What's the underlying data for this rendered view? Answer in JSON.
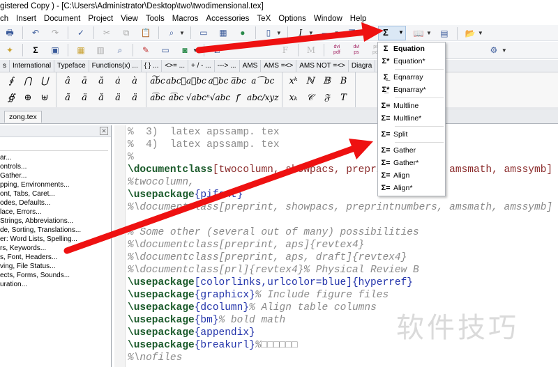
{
  "title": "gistered  Copy ) - [C:\\Users\\Administrator\\Desktop\\two\\twodimensional.tex]",
  "menu": [
    "ch",
    "Insert",
    "Document",
    "Project",
    "View",
    "Tools",
    "Macros",
    "Accessories",
    "TeX",
    "Options",
    "Window",
    "Help"
  ],
  "toolbar2_text": {
    "L": "L",
    "F": "F",
    "M": "M",
    "dvipdf": "dvi pdf",
    "dvips": "dvi ps",
    "pspdf": "ps pdf"
  },
  "symbol_tabs": [
    "s",
    "International",
    "Typeface",
    "Functions(x) ...",
    "{ } ...",
    "<>= ...",
    "+ / - ...",
    "---> ...",
    "AMS",
    "AMS =<>",
    "AMS NOT =<>",
    "Diagra"
  ],
  "symbols": {
    "g1": [
      "∮",
      "∯",
      "⋂",
      "⊕",
      "⋃",
      "⊎"
    ],
    "g2": [
      "â",
      "ã",
      "ā",
      "ä",
      "ă",
      "ă",
      "ȧ",
      "ä",
      "à",
      "ä"
    ],
    "g3": [
      "a͠bc",
      "a͡bc",
      "abc⃖",
      "a͡bc",
      "a⃖bc",
      "√abc",
      "a⃗bc",
      "ⁿ√abc",
      "a̅bc",
      "f′",
      "a⏜bc",
      "abc/xyz"
    ],
    "g4": [
      "xᵏ",
      "xₖ",
      "ℕ",
      "𝒞",
      "𝔹",
      "𝔉",
      "B",
      "T"
    ]
  },
  "file_tab": "zong.tex",
  "left_panel": {
    "items": [
      "ar...",
      "ontrols...",
      "Gather...",
      "pping, Environments...",
      "ont, Tabs, Caret...",
      "odes, Defaults...",
      "lace, Errors...",
      "Strings, Abbreviations...",
      "de, Sorting, Translations...",
      "er: Word Lists, Spelling...",
      "rs, Keywords...",
      "s, Font, Headers...",
      "ving, File Status...",
      "ects, Forms, Sounds...",
      "uration..."
    ]
  },
  "editor": {
    "lines": [
      {
        "t": "cm",
        "s": "%  3)  latex apssamp. tex"
      },
      {
        "t": "cm",
        "s": "%  4)  latex apssamp. tex"
      },
      {
        "t": "cm",
        "s": "%"
      },
      {
        "t": "code",
        "k": "\\documentclass",
        "a": "[twocolumn, showpacs, preprintnumbers, amsmath, amssymb]"
      },
      {
        "t": "cm",
        "s": "%twocolumn,"
      },
      {
        "t": "code",
        "k": "\\usepackage",
        "a": "{pifont}"
      },
      {
        "t": "cm",
        "s": "%\\documentclass[preprint, showpacs, preprintnumbers, amsmath, amssymb]"
      },
      {
        "t": "cm",
        "s": ""
      },
      {
        "t": "cm",
        "s": "% Some other (several out of many) possibilities"
      },
      {
        "t": "cm",
        "s": "%\\documentclass[preprint, aps]{revtex4}"
      },
      {
        "t": "cm",
        "s": "%\\documentclass[preprint, aps, draft]{revtex4}"
      },
      {
        "t": "cm",
        "s": "%\\documentclass[prl]{revtex4}% Physical Review B"
      },
      {
        "t": "code",
        "k": "\\usepackage",
        "a": "[colorlinks,urlcolor=blue]{hyperref}"
      },
      {
        "t": "code",
        "k": "\\usepackage",
        "a": "{graphicx}",
        "c": "% Include figure files"
      },
      {
        "t": "code",
        "k": "\\usepackage",
        "a": "{dcolumn}",
        "c": "% Align table columns"
      },
      {
        "t": "code",
        "k": "\\usepackage",
        "a": "{bm}",
        "c": "% bold math"
      },
      {
        "t": "code",
        "k": "\\usepackage",
        "a": "{appendix}"
      },
      {
        "t": "code",
        "k": "\\usepackage",
        "a": "{breakurl}",
        "c": "%□□□□□□"
      },
      {
        "t": "cm",
        "s": "%\\nofiles"
      }
    ]
  },
  "equation_menu": {
    "button_icon": "sigma-icon",
    "items": [
      {
        "label": "Equation",
        "glyph": "Σ",
        "bold": true
      },
      {
        "label": "Equation*",
        "glyph": "Σ*"
      },
      {
        "sep": true
      },
      {
        "label": "Eqnarray",
        "glyph": "Σ̲"
      },
      {
        "label": "Eqnarray*",
        "glyph": "Σ̲*"
      },
      {
        "sep": true
      },
      {
        "label": "Multline",
        "glyph": "Σ≡"
      },
      {
        "label": "Multline*",
        "glyph": "Σ≡"
      },
      {
        "sep": true
      },
      {
        "label": "Split",
        "glyph": "Σ="
      },
      {
        "sep": true
      },
      {
        "label": "Gather",
        "glyph": "Σ="
      },
      {
        "label": "Gather*",
        "glyph": "Σ="
      },
      {
        "label": "Align",
        "glyph": "Σ="
      },
      {
        "label": "Align*",
        "glyph": "Σ="
      }
    ]
  },
  "watermark": "软件技巧",
  "colors": {
    "arrow": "#ee1111",
    "keyword": "#1a5a2a",
    "brace": "#2233aa",
    "comment": "#8a8a8a"
  }
}
